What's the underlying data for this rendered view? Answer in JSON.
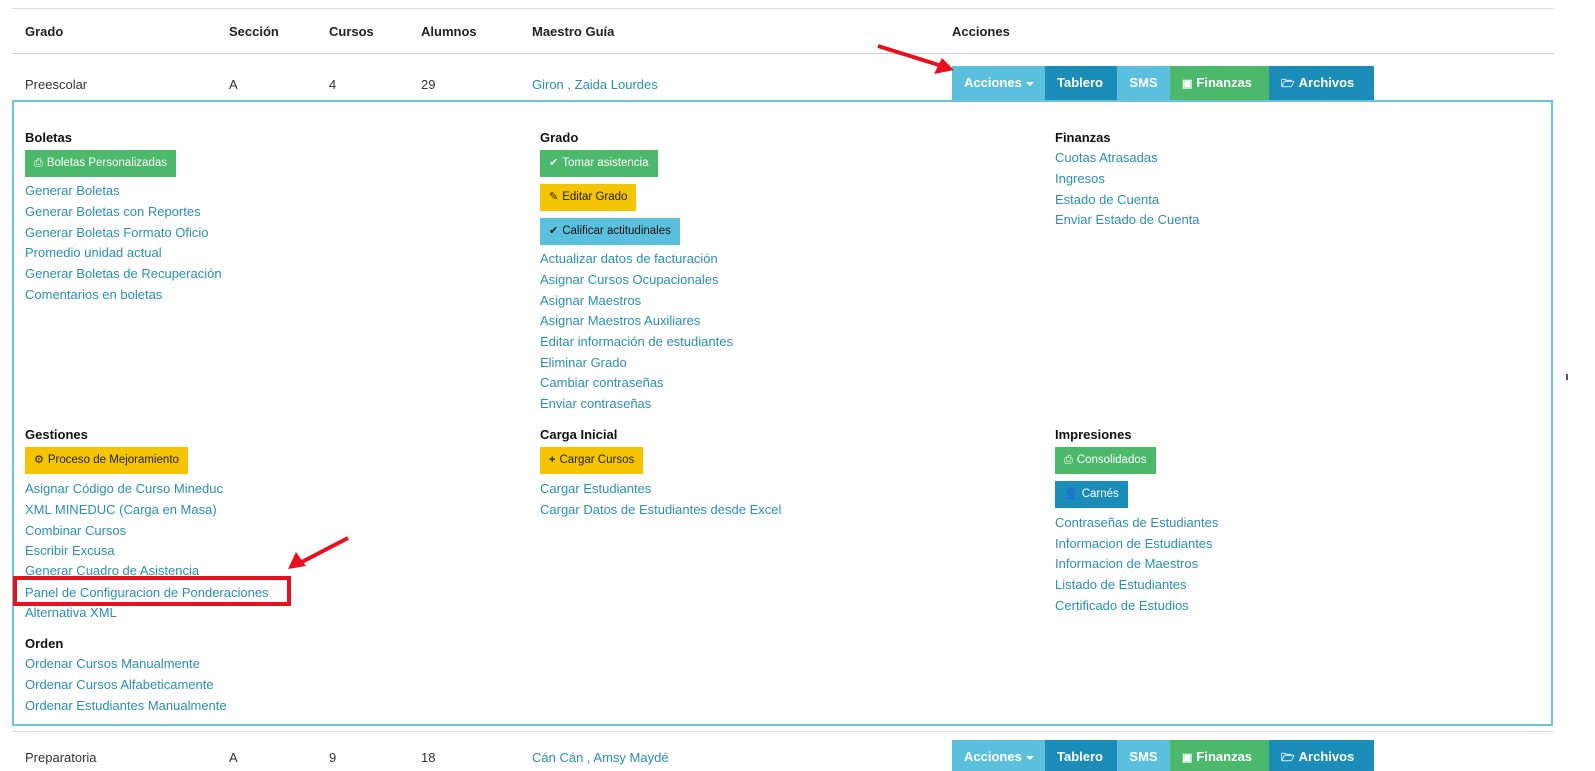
{
  "table": {
    "headers": [
      "Grado",
      "Sección",
      "Cursos",
      "Alumnos",
      "Maestro Guía",
      "Acciones"
    ],
    "rows": [
      {
        "grado": "Preescolar",
        "seccion": "A",
        "cursos": "4",
        "alumnos": "29",
        "maestro": "Giron , Zaida Lourdes"
      },
      {
        "grado": "Preparatoria",
        "seccion": "A",
        "cursos": "9",
        "alumnos": "18",
        "maestro": "Cán Cán , Amsy Maydé"
      }
    ],
    "action_buttons": {
      "acciones": "Acciones",
      "tablero": "Tablero",
      "sms": "SMS",
      "finanzas": "Finanzas",
      "archivos": "Archivos"
    }
  },
  "panel": {
    "boletas": {
      "title": "Boletas",
      "button": "Boletas Personalizadas",
      "links": [
        "Generar Boletas",
        "Generar Boletas con Reportes",
        "Generar Boletas Formato Oficio",
        "Promedio unidad actual",
        "Generar Boletas de Recuperación",
        "Comentarios en boletas"
      ]
    },
    "grado": {
      "title": "Grado",
      "buttons": [
        "Tomar asistencia",
        "Editar Grado",
        "Calificar actitudinales"
      ],
      "links": [
        "Actualizar datos de facturación",
        "Asignar Cursos Ocupacionales",
        "Asignar Maestros",
        "Asignar Maestros Auxiliares",
        "Editar información de estudiantes",
        "Eliminar Grado",
        "Cambiar contraseñas",
        "Enviar contraseñas"
      ]
    },
    "finanzas": {
      "title": "Finanzas",
      "links": [
        "Cuotas Atrasadas",
        "Ingresos",
        "Estado de Cuenta",
        "Enviar Estado de Cuenta"
      ]
    },
    "gestiones": {
      "title": "Gestiones",
      "button": "Proceso de Mejoramiento",
      "links": [
        "Asignar Código de Curso Mineduc",
        "XML MINEDUC (Carga en Masa)",
        "Combinar Cursos",
        "Escribir Excusa",
        "Generar Cuadro de Asistencia",
        "Panel de Configuracion de Ponderaciones",
        "Alternativa XML"
      ]
    },
    "carga": {
      "title": "Carga Inicial",
      "button": "Cargar Cursos",
      "links": [
        "Cargar Estudiantes",
        "Cargar Datos de Estudiantes desde Excel"
      ]
    },
    "impresiones": {
      "title": "Impresiones",
      "buttons": [
        "Consolidados",
        "Carnés"
      ],
      "links": [
        "Contraseñas de Estudiantes",
        "Informacion de Estudiantes",
        "Informacion de Maestros",
        "Listado de Estudiantes",
        "Certificado de Estudios"
      ]
    },
    "orden": {
      "title": "Orden",
      "links": [
        "Ordenar Cursos Manualmente",
        "Ordenar Cursos Alfabeticamente",
        "Ordenar Estudiantes Manualmente"
      ]
    }
  },
  "colors": {
    "link": "#2a8fb4",
    "info": "#5bc0de",
    "primary": "#1b8db8",
    "success": "#4cb86b",
    "warning": "#f4c400",
    "annotation": "#e8101e"
  }
}
